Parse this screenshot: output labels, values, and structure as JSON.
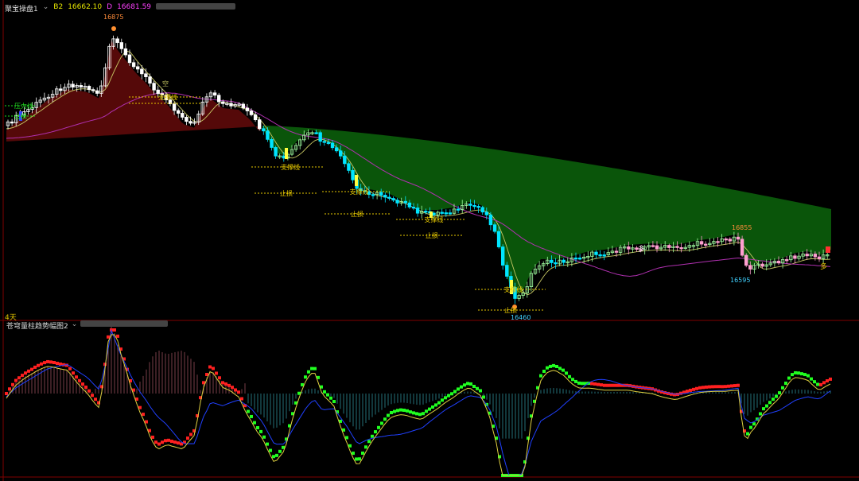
{
  "header": {
    "window_title": "聚宝操盘1",
    "b2_label": "B2",
    "b2_value": "16662.10",
    "d_label": "D",
    "d_value": "16681.59",
    "chevron": "chevron-down-icon"
  },
  "subpanel": {
    "period_label": "4天",
    "indicator_title": "苍穹量柱趋势幅图2"
  },
  "labels": {
    "stop_loss": "止损",
    "support": "支撑线",
    "resistance": "压力线",
    "bull": "多",
    "bear": "空"
  },
  "annotations": {
    "high_price": "16875",
    "low_price": "16460",
    "recent_high": "16855",
    "recent_low": "16595"
  },
  "colors": {
    "bg": "#000000",
    "bull_candle": "#ffffff",
    "bear_candle": "#00e5ff",
    "green_cloud": "#0b5a0b",
    "red_cloud": "#5a0a0a",
    "ma_yellow": "#c8c864",
    "ma_purple": "#b030b0",
    "dotted": "#e6c800",
    "macd_red": "#ff2020",
    "macd_green": "#20ff20",
    "axis": "#800000"
  },
  "chart_data": [
    {
      "type": "line",
      "title": "",
      "annotated_extrema": {
        "high": 16875,
        "low": 16460,
        "recent_high": 16855,
        "recent_low": 16595
      }
    },
    {
      "type": "bar",
      "title": "苍穹量柱趋势幅图2"
    }
  ]
}
